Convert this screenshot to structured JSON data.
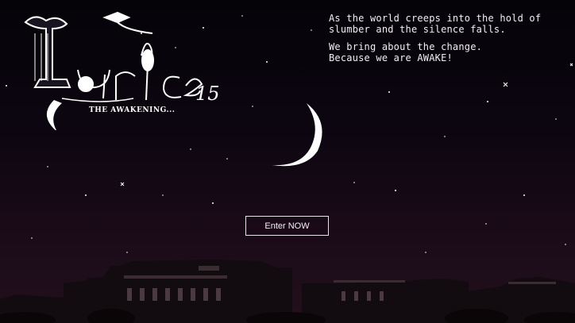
{
  "logo": {
    "wordmark": "Lyrics 15",
    "subtitle": "THE AWAKENING..."
  },
  "tagline": {
    "line1": "As the world creeps into the hold of",
    "line2": "slumber and the silence falls.",
    "line3": "We bring about the change.",
    "line4": "Because we are AWAKE!"
  },
  "enter_button": {
    "label": "Enter NOW"
  },
  "icons": {
    "moon": "crescent-moon-icon",
    "skyline": "building-silhouette"
  },
  "colors": {
    "sky_top": "#050308",
    "sky_bottom": "#22101c",
    "text": "#f2eef4"
  }
}
